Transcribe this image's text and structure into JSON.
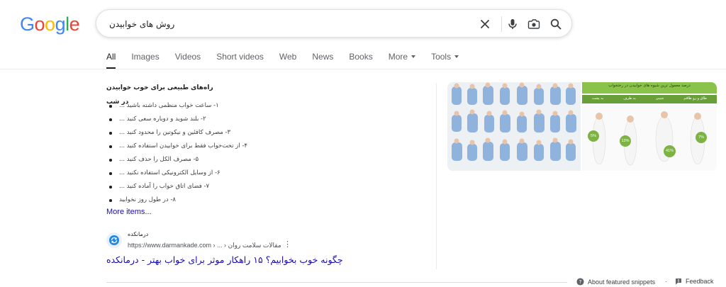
{
  "logo": {
    "letters": [
      "G",
      "o",
      "o",
      "g",
      "l",
      "e"
    ],
    "colors": [
      "#4285F4",
      "#EA4335",
      "#FBBC05",
      "#4285F4",
      "#34A853",
      "#EA4335"
    ]
  },
  "search": {
    "query": "روش های خوابیدن"
  },
  "icons": {
    "clear": "close-icon",
    "voice": "microphone-icon",
    "lens": "camera-lens-icon",
    "search": "search-icon"
  },
  "tabs": [
    {
      "label": "All",
      "active": true
    },
    {
      "label": "Images"
    },
    {
      "label": "Videos"
    },
    {
      "label": "Short videos"
    },
    {
      "label": "Web"
    },
    {
      "label": "News"
    },
    {
      "label": "Books"
    },
    {
      "label": "More",
      "dropdown": true
    },
    {
      "label": "Tools",
      "dropdown": true
    }
  ],
  "snippet": {
    "title": "راه‌های طبیعی برای خوب خوابیدن در شب",
    "items": [
      "۱- ساعت خواب منظمی داشته باشید ...",
      "۲- بلند شوید و دوباره سعی کنید ...",
      "۳- مصرف کافئین و نیکوتین را محدود کنید ...",
      "۴- از تخت‌خواب فقط برای خوابیدن استفاده کنید ...",
      "۵- مصرف الکل را حذف کنید ...",
      "۶- از وسایل الکترونیکی استفاده نکنید ...",
      "۷- فضای اتاق خواب را آماده کنید ...",
      "۸- در طول روز نخوابید"
    ],
    "more_items": "More items..."
  },
  "source": {
    "site_name": "درمانکده",
    "url": "https://www.darmankade.com › ... › مقالات سلامت روان",
    "title": "چگونه خوب بخوابیم؟ ۱۵ راهکار موثر برای خواب بهتر - درمانکده"
  },
  "image2": {
    "header": "درصد معمول ترین شیوه های خوابیدن در رختخواب",
    "columns": [
      "به پشت",
      "به طرف",
      "جنینی",
      "طاق و رو طاقم"
    ],
    "percents": [
      "5%",
      "13%",
      "41%",
      "7%"
    ]
  },
  "footer": {
    "about": "About featured snippets",
    "separator": "·",
    "feedback": "Feedback"
  }
}
